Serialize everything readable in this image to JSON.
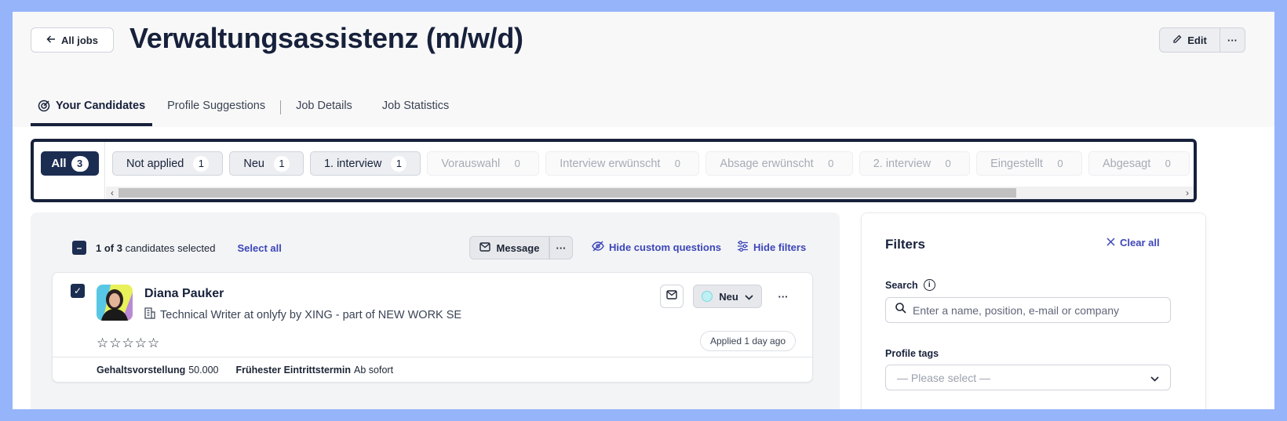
{
  "header": {
    "back_label": "All jobs",
    "job_title": "Verwaltungsassistenz (m/w/d)",
    "edit_label": "Edit",
    "more_label": "···"
  },
  "tabs": [
    {
      "label": "Your Candidates",
      "active": true
    },
    {
      "label": "Profile Suggestions"
    },
    {
      "label": "Job Details"
    },
    {
      "label": "Job Statistics"
    }
  ],
  "stages": {
    "all_label": "All",
    "all_count": "3",
    "items": [
      {
        "label": "Not applied",
        "count": "1"
      },
      {
        "label": "Neu",
        "count": "1"
      },
      {
        "label": "1. interview",
        "count": "1"
      },
      {
        "label": "Vorauswahl",
        "count": "0"
      },
      {
        "label": "Interview erwünscht",
        "count": "0"
      },
      {
        "label": "Absage erwünscht",
        "count": "0"
      },
      {
        "label": "2. interview",
        "count": "0"
      },
      {
        "label": "Eingestellt",
        "count": "0"
      },
      {
        "label": "Abgesagt",
        "count": "0"
      }
    ]
  },
  "selection": {
    "count_text": "1 of 3",
    "suffix": "candidates selected",
    "select_all": "Select all",
    "message_label": "Message",
    "more_label": "···",
    "hide_questions": "Hide custom questions",
    "hide_filters": "Hide filters"
  },
  "candidate": {
    "name": "Diana Pauker",
    "position": "Technical Writer at onlyfy by XING - part of NEW WORK SE",
    "status": "Neu",
    "applied": "Applied 1 day ago",
    "rating": 0,
    "salary_label": "Gehaltsvorstellung",
    "salary_value": "50.000",
    "start_label": "Frühester Eintrittstermin",
    "start_value": "Ab sofort",
    "more_label": "···"
  },
  "filters": {
    "title": "Filters",
    "clear_all": "Clear all",
    "search_label": "Search",
    "search_placeholder": "Enter a name, position, e-mail or company",
    "tags_label": "Profile tags",
    "tags_placeholder": "— Please select —"
  },
  "colors": {
    "navy": "#17213b",
    "accent_link": "#3c46b8",
    "page_bg": "#95b4fa",
    "status_dot": "#bff0f4"
  }
}
